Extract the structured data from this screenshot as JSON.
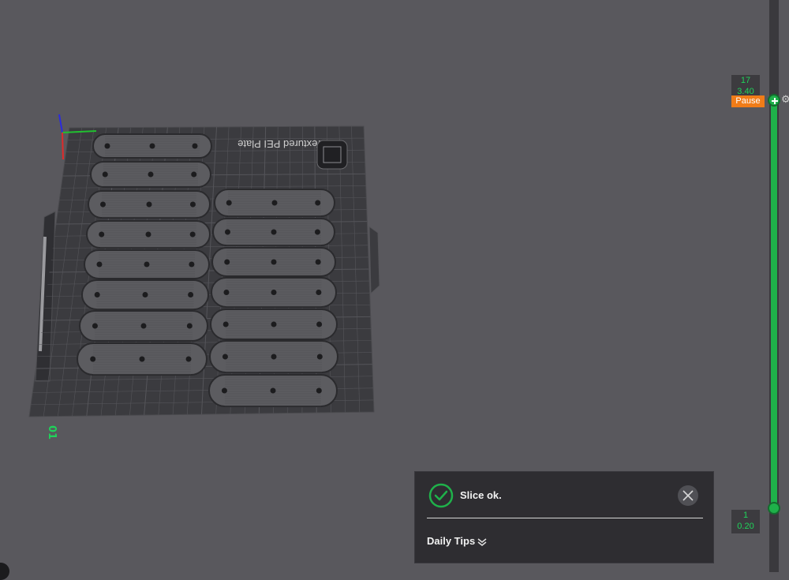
{
  "viewport": {
    "plate_label": "Textured PEI Plate",
    "plate_number": "01",
    "colors": {
      "background": "#59585d",
      "plate": "#3b3b3f",
      "grid": "#58585c",
      "part": "#5c5c60"
    }
  },
  "layer_slider": {
    "top_layer": "17",
    "top_height": "3.40",
    "pause_label": "Pause",
    "bottom_layer": "1",
    "bottom_height": "0.20",
    "accent_color": "#1fb14a",
    "pause_color": "#f07c18"
  },
  "notification": {
    "message": "Slice ok.",
    "tips_label": "Daily Tips",
    "icons": {
      "status": "check-circle-icon",
      "close": "close-icon",
      "expand": "double-chevron-down-icon"
    }
  }
}
